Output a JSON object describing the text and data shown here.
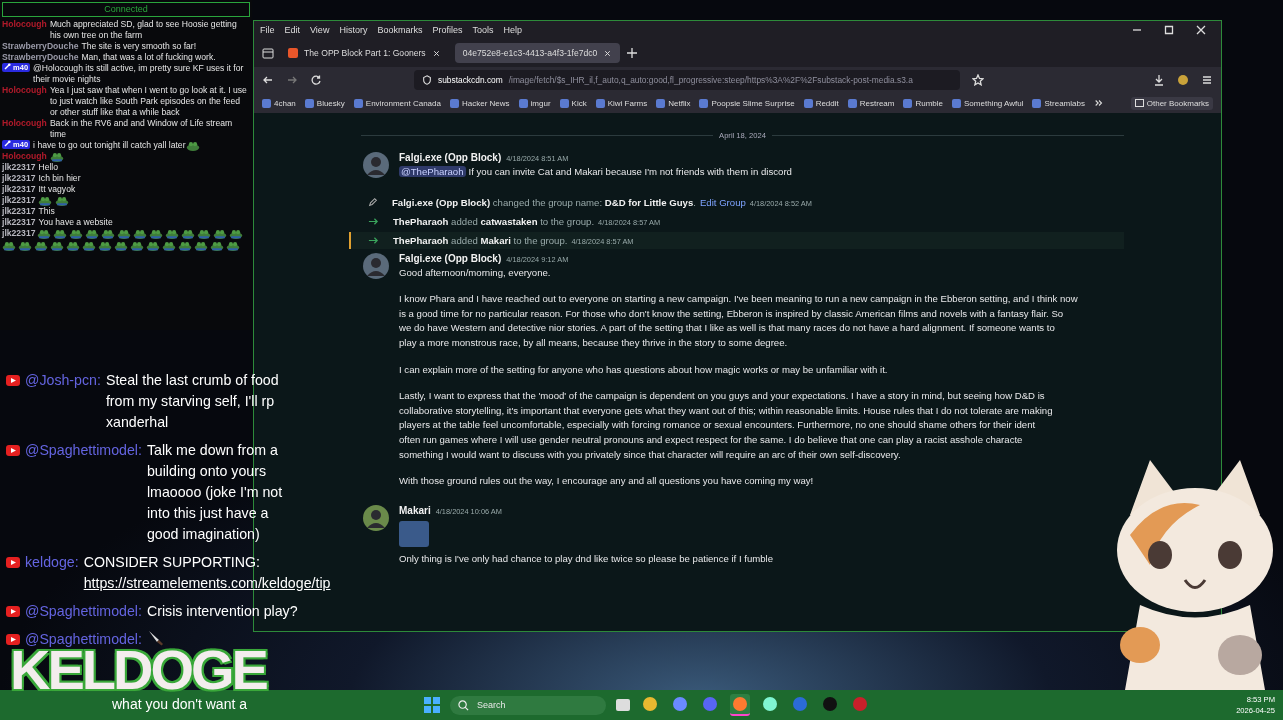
{
  "twitch_chat": {
    "status": "Connected",
    "messages": [
      {
        "kind": "text",
        "user": "Holocough",
        "color": "#b01a2a",
        "text": "Much appreciated SD, glad to see Hoosie getting his own tree on the farm"
      },
      {
        "kind": "text",
        "user": "StrawberryDouche",
        "color": "#9a9aa8",
        "text": "The site is very smooth so far!"
      },
      {
        "kind": "text",
        "user": "StrawberryDouche",
        "color": "#9a9aa8",
        "text": "Man, that was a lot of fucking work."
      },
      {
        "kind": "text",
        "badge": "m40",
        "text": "@Holocough its still active, im pretty sure KF uses it for their movie nights"
      },
      {
        "kind": "text",
        "user": "Holocough",
        "color": "#b01a2a",
        "text": "Yea I just saw that when I went to go look at it.  I use to just watch like South Park episodes on the feed or other stuff like that a while back"
      },
      {
        "kind": "text",
        "user": "Holocough",
        "color": "#b01a2a",
        "text": "Back in the RV6 and and Window of Life stream time"
      },
      {
        "kind": "text",
        "badge": "m40",
        "text": "i have to go out tonight ill catch yall later",
        "emote_after": true
      },
      {
        "kind": "emote",
        "user": "Holocough",
        "color": "#b01a2a"
      },
      {
        "kind": "text",
        "user": "jlk22317",
        "color": "#b8b8c0",
        "text": "Hello"
      },
      {
        "kind": "text",
        "user": "jlk22317",
        "color": "#b8b8c0",
        "text": "Ich bin hier"
      },
      {
        "kind": "text",
        "user": "jlk22317",
        "color": "#b8b8c0",
        "text": "Itt vagyok"
      },
      {
        "kind": "emote-pair",
        "user": "jlk22317",
        "color": "#b8b8c0"
      },
      {
        "kind": "text",
        "user": "jlk22317",
        "color": "#b8b8c0",
        "text": "This"
      },
      {
        "kind": "text",
        "user": "jlk22317",
        "color": "#b8b8c0",
        "text": "You have a website"
      },
      {
        "kind": "emote-wall",
        "user": "jlk22317",
        "color": "#b8b8c0"
      }
    ]
  },
  "browser": {
    "menu": [
      "File",
      "Edit",
      "View",
      "History",
      "Bookmarks",
      "Profiles",
      "Tools",
      "Help"
    ],
    "tabs": [
      {
        "label": "The OPP Block Part 1: Gooners",
        "selected": false
      },
      {
        "label": "04e752e8-e1c3-4413-a4f3-1fe7dc0",
        "selected": true
      }
    ],
    "url_domain": "substackcdn.com",
    "url_path": "/image/fetch/$s_IHR_il,f_auto,q_auto:good,fl_progressive:steep/https%3A%2F%2Fsubstack-post-media.s3.a",
    "bookmarks": [
      "4chan",
      "Bluesky",
      "Environment Canada",
      "Hacker News",
      "imgur",
      "Kick",
      "Kiwi Farms",
      "Netflix",
      "Poopsie Slime Surprise",
      "Reddit",
      "Restream",
      "Rumble",
      "Something Awful",
      "Streamlabs"
    ],
    "other_bookmarks": "Other Bookmarks"
  },
  "conversation": {
    "date": "April 18, 2024",
    "items": [
      {
        "kind": "message",
        "author": "Falgi.exe (Opp Block)",
        "time": "4/18/2024 8:51 AM",
        "mention": "@ThePharaoh",
        "paragraphs": [
          [
            "If you can invite Cat and Makari because I'm not friends with them in discord"
          ]
        ]
      },
      {
        "kind": "rename",
        "text": "**Falgi.exe (Opp Block)** changed the group name: **D&D for Little Guys**.",
        "link": "Edit Group",
        "time": "4/18/2024 8:52 AM",
        "highlighted": false
      },
      {
        "kind": "member-add",
        "text": "**ThePharaoh** added **catwastaken** to the group.",
        "time": "4/18/2024 8:57 AM",
        "highlighted": false
      },
      {
        "kind": "member-add",
        "text": "**ThePharaoh** added **Makari** to the group.",
        "time": "4/18/2024 8:57 AM",
        "highlighted": true
      },
      {
        "kind": "message",
        "author": "Falgi.exe (Opp Block)",
        "time": "4/18/2024 9:12 AM",
        "paragraphs": [
          [
            "Good afternoon/morning, everyone."
          ],
          [
            "I know Phara and I have reached out to everyone on starting a new campaign. I've been meaning to run a new campaign in the Ebberon setting, and I think now",
            "is a good time for no particular reason. For those who don't know the setting, Ebberon is inspired by classic American films and novels with a fantasy flair. So",
            "we do have Western and detective nior stories. A part of the setting that I like as well is that many races do not have a hard alignment. If someone wants to",
            "play a more monstrous race, by all means, because they thrive in the story to some degree."
          ],
          [
            "I can explain more of the setting for anyone who has questions about how magic works or may be unfamiliar with it."
          ],
          [
            "Lastly, I want to express that the 'mood' of the campaign is dependent on you guys and your expectations. I have a story in mind, but seeing how D&D is",
            "collaborative storytelling, it's important that everyone gets what they want out of this; within reasonable limits. House rules that I do not tolerate are making",
            "players at the table feel uncomfortable, especially with forcing romance or sexual encounters. Furthermore, no one should shame others for their ident",
            "often run games where I will use gender neutral pronouns and expect respect for the same. I do believe that one can play a racist asshole characte",
            "something I would want to discuss with you privately since that character will require an arc of their own self-discovery."
          ],
          [
            "With those ground rules out the way, I encourage any and all questions you have coming my way!"
          ]
        ]
      },
      {
        "kind": "message",
        "author": "Makari",
        "time": "4/18/2024 10:06 AM",
        "attachment": true,
        "paragraphs": [
          [
            "Only thing is I've only had chance to play dnd like twice so please be patience if I fumble"
          ]
        ]
      }
    ]
  },
  "youtube_chat": {
    "messages": [
      {
        "kind": "text",
        "user": "@Josh-pcn:",
        "text": "Steal the last crumb of food from my starving self, I'll rp xanderhal"
      },
      {
        "kind": "text",
        "user": "@Spaghettimodel:",
        "text": "Talk me down from a building onto yours lmaoooo (joke I'm not into this just have a good imagination)"
      },
      {
        "kind": "text",
        "user": "keldoge:",
        "text": "CONSIDER SUPPORTING:",
        "link": "https://streamelements.com/keldoge/tip"
      },
      {
        "kind": "text",
        "user": "@Spaghettimodel:",
        "text": "Crisis intervention play?"
      },
      {
        "kind": "knife",
        "user": "@Spaghettimodel:"
      }
    ],
    "last_line": "what you don't want a"
  },
  "logo_text": "KELDOGE",
  "taskbar": {
    "search": "Search",
    "time": "8:53 PM",
    "date": "2026-04-25",
    "apps": [
      {
        "kind": "explorer",
        "selected": false
      },
      {
        "kind": "copilot",
        "selected": false
      },
      {
        "kind": "discord",
        "selected": false
      },
      {
        "kind": "firefox",
        "selected": true
      },
      {
        "kind": "streamlabs",
        "selected": false
      },
      {
        "kind": "word",
        "selected": false
      },
      {
        "kind": "r",
        "selected": false
      },
      {
        "kind": "youtube",
        "selected": false
      }
    ]
  }
}
